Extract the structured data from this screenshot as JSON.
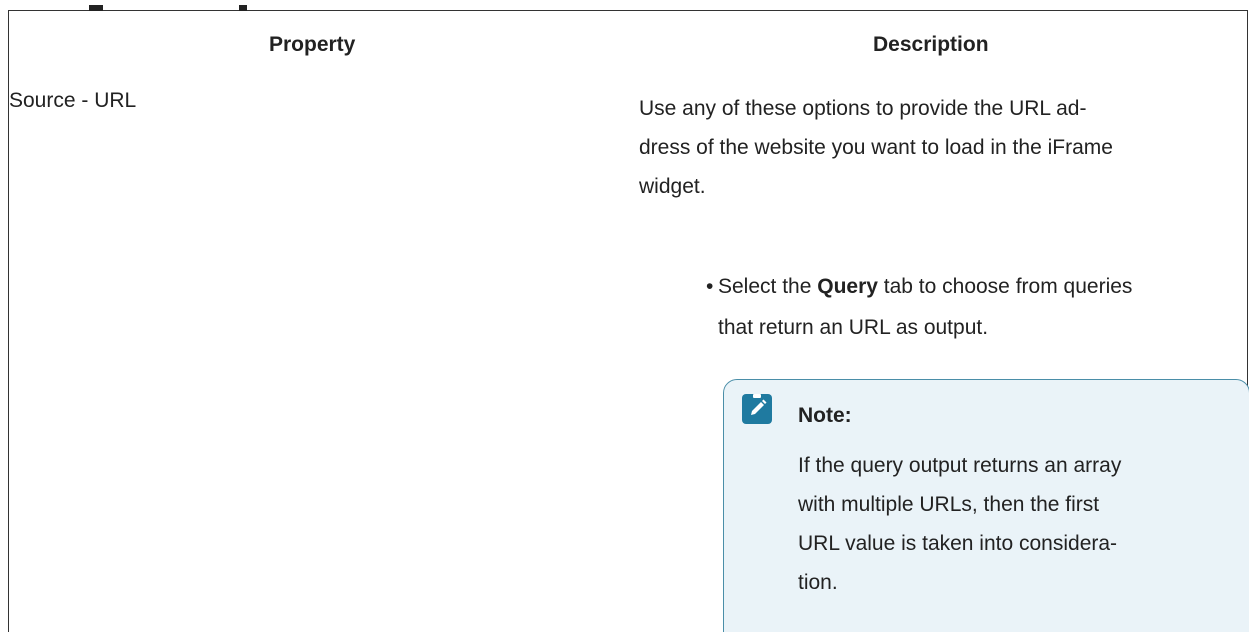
{
  "table": {
    "headers": {
      "property": "Property",
      "description": "Description"
    },
    "rows": [
      {
        "property": "Source - URL",
        "description_lines": [
          "Use any of these options to provide the URL ad-",
          "dress of the website you want to load in the iFrame",
          "widget."
        ],
        "bullets": [
          {
            "prefix": "Select the ",
            "bold": "Query",
            "suffix": " tab to choose from queries",
            "line2": "that return an URL as output."
          }
        ],
        "note": {
          "icon": "pencil-note-icon",
          "title": "Note:",
          "lines": [
            "If the query output returns an array",
            "with multiple URLs, then the first",
            "URL value is taken into considera-",
            "tion."
          ]
        }
      }
    ]
  },
  "colors": {
    "note_background": "#eaf3f8",
    "note_border": "#4a8ea8",
    "note_icon": "#1f7aa0"
  }
}
